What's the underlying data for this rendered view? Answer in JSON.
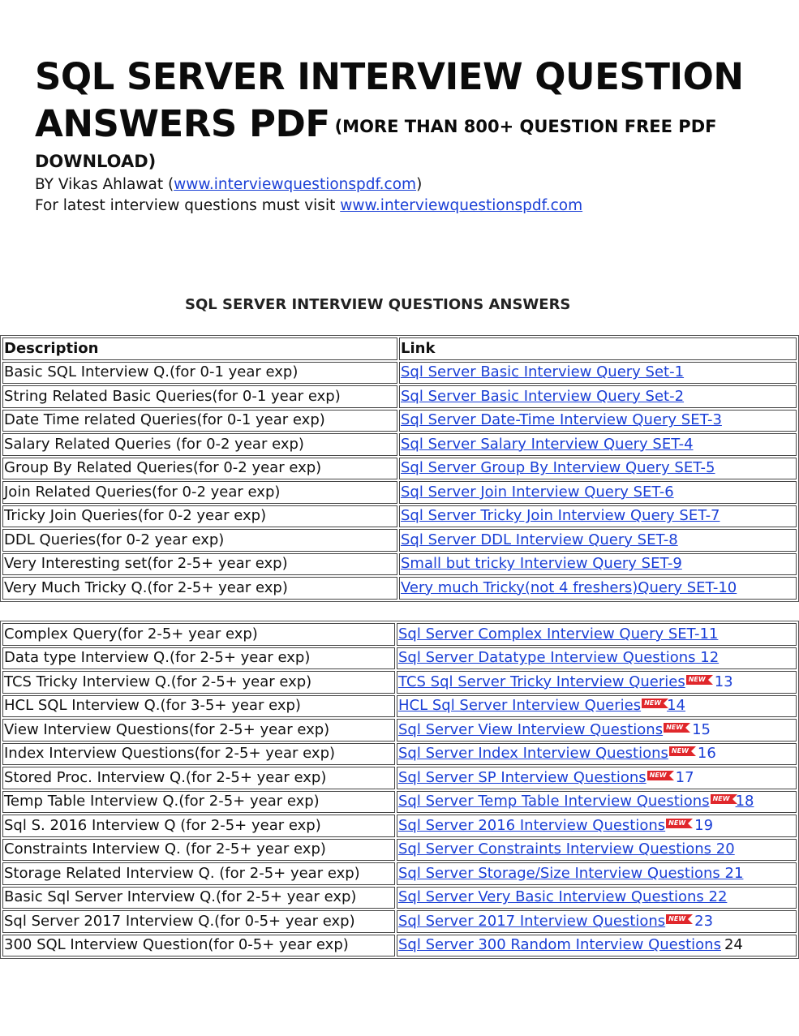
{
  "header": {
    "title_line1": "SQL SERVER INTERVIEW QUESTION",
    "title_line2": "ANSWERS PDF",
    "subtitle_part1": "(MORE THAN 800+ QUESTION FREE PDF",
    "subtitle_part2": "DOWNLOAD)",
    "byline_prefix": "BY Vikas Ahlawat (",
    "byline_link": "www.interviewquestionspdf.com",
    "byline_suffix": ")",
    "visit_prefix": "For latest interview questions must visit ",
    "visit_link": "www.interviewquestionspdf.com"
  },
  "table_caption": "SQL SERVER INTERVIEW QUESTIONS ANSWERS",
  "table1": {
    "headers": [
      "Description",
      "Link"
    ],
    "rows": [
      {
        "desc": "Basic SQL Interview Q.(for 0-1 year exp)",
        "link": "Sql Server Basic Interview Query Set-1"
      },
      {
        "desc": "String Related Basic Queries(for 0-1 year exp)",
        "link": "Sql Server Basic Interview Query Set-2"
      },
      {
        "desc": "Date Time related Queries(for 0-1 year exp)",
        "link": "Sql Server Date-Time Interview Query SET-3"
      },
      {
        "desc": "Salary Related Queries (for 0-2 year exp)",
        "link": "Sql Server Salary Interview Query SET-4"
      },
      {
        "desc": "Group By Related Queries(for 0-2 year exp)",
        "link": "Sql Server Group By Interview Query SET-5"
      },
      {
        "desc": "Join Related Queries(for 0-2 year exp)",
        "link": "Sql Server Join Interview Query SET-6"
      },
      {
        "desc": "Tricky Join Queries(for 0-2 year exp)",
        "link": "Sql Server Tricky Join Interview Query SET-7"
      },
      {
        "desc": "DDL Queries(for 0-2 year exp)",
        "link": "Sql Server DDL Interview Query SET-8"
      },
      {
        "desc": "Very Interesting set(for 2-5+ year exp)",
        "link": "Small but tricky Interview Query SET-9"
      },
      {
        "desc": "Very Much Tricky Q.(for 2-5+ year exp)",
        "link": "Very much Tricky(not 4 freshers)Query SET-10"
      }
    ]
  },
  "table2": {
    "badge_text": "NEW",
    "rows": [
      {
        "desc": "Complex Query(for 2-5+ year exp)",
        "link": "Sql Server Complex Interview Query SET-11",
        "badge": false,
        "num": "",
        "num_style": ""
      },
      {
        "desc": "Data type Interview Q.(for 2-5+ year exp)",
        "link": "Sql Server Datatype Interview Questions  12",
        "badge": false,
        "num": "",
        "num_style": ""
      },
      {
        "desc": "TCS Tricky Interview Q.(for 2-5+ year exp)",
        "link": "TCS Sql Server Tricky Interview Queries",
        "badge": true,
        "num": "13",
        "num_style": "plain-blue"
      },
      {
        "desc": "HCL SQL  Interview Q.(for 3-5+ year exp)",
        "link": "HCL Sql Server Interview Queries",
        "badge": true,
        "num": "14",
        "num_style": "link"
      },
      {
        "desc": "View Interview Questions(for 2-5+ year exp)",
        "link": "Sql Server View Interview Questions",
        "badge": true,
        "num": "15",
        "num_style": "plain-blue"
      },
      {
        "desc": "Index Interview Questions(for 2-5+ year exp)",
        "link": "Sql Server Index Interview Questions",
        "badge": true,
        "num": "16",
        "num_style": "plain-blue"
      },
      {
        "desc": "Stored Proc. Interview Q.(for 2-5+ year exp)",
        "link": "Sql Server SP Interview Questions",
        "badge": true,
        "num": "17",
        "num_style": "plain-blue"
      },
      {
        "desc": "Temp Table Interview Q.(for 2-5+ year exp)",
        "link": "Sql Server Temp Table Interview Questions",
        "badge": true,
        "num": "18",
        "num_style": "link"
      },
      {
        "desc": "Sql S. 2016 Interview Q (for 2-5+ year exp)",
        "link": "Sql Server 2016 Interview Questions",
        "badge": true,
        "num": "19",
        "num_style": "plain-blue"
      },
      {
        "desc": "Constraints Interview Q. (for 2-5+ year exp)",
        "link": "Sql Server Constraints Interview Questions 20",
        "badge": false,
        "num": "",
        "num_style": ""
      },
      {
        "desc": "Storage Related Interview Q. (for 2-5+ year exp)",
        "link": "Sql Server Storage/Size Interview Questions 21",
        "badge": false,
        "num": "",
        "num_style": ""
      },
      {
        "desc": "Basic Sql Server Interview Q.(for 2-5+ year exp)",
        "link": "Sql Server Very Basic Interview Questions 22",
        "badge": false,
        "num": "",
        "num_style": ""
      },
      {
        "desc": "Sql Server 2017 Interview Q.(for 0-5+ year exp)",
        "link": "Sql Server 2017 Interview Questions",
        "badge": true,
        "num": "23",
        "num_style": "plain-blue"
      },
      {
        "desc": "300 SQL Interview Question(for 0-5+ year exp)",
        "link": "Sql Server 300 Random Interview Questions",
        "badge": false,
        "num": "24",
        "num_style": "plain"
      }
    ]
  }
}
